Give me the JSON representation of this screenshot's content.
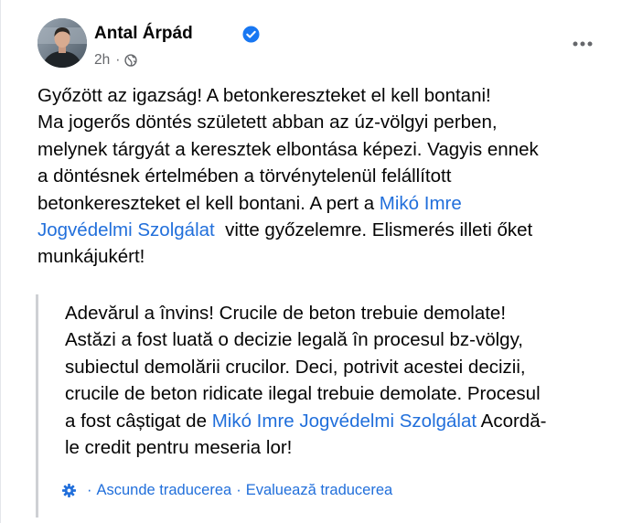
{
  "post": {
    "author": "Antal Árpád",
    "verified": true,
    "time": "2h",
    "separator": "·",
    "audience_icon": "globe-icon",
    "more_icon": "more-options-icon",
    "text_lines": [
      [
        "Győzött az igazság! A betonkereszteket el kell bontani!"
      ],
      [
        "Ma jogerős döntés született abban az úz-völgyi perben,"
      ],
      [
        "melynek tárgyát a keresztek elbontása képezi. Vagyis ennek"
      ],
      [
        "a döntésnek értelmében a törvénytelenül felállított"
      ],
      [
        "betonkereszteket el kell bontani. A pert a ",
        "Mikó Imre"
      ],
      [
        "Jogvédelmi Szolgálat",
        "  vitte győzelemre. Elismerés illeti őket"
      ],
      [
        "munkájukért!"
      ]
    ],
    "link_text_part1": "Mikó Imre",
    "link_text_part2": "Jogvédelmi Szolgálat"
  },
  "translation": {
    "text_lines": [
      "Adevărul a învins! Crucile de beton trebuie demolate!",
      "Astăzi a fost luată o decizie legală în procesul bz-völgy,",
      "subiectul demolării crucilor. Deci, potrivit acestei decizii,",
      "crucile de beton ridicate ilegal trebuie demolate. Procesul"
    ],
    "line5_before": "a fost câștigat de ",
    "line5_link": "Mikó Imre Jogvédelmi Szolgálat",
    "line5_after": " Acordă-",
    "line6": "le credit pentru meseria lor!",
    "footer": {
      "settings_icon": "gear-icon",
      "separator": "·",
      "hide_label": "Ascunde traducerea",
      "rate_label": "Evaluează traducerea"
    }
  },
  "colors": {
    "link": "#216fdb",
    "text": "#050505",
    "muted": "#65676b",
    "verified_badge": "#1877f2",
    "quote_border": "#ced0d4"
  }
}
